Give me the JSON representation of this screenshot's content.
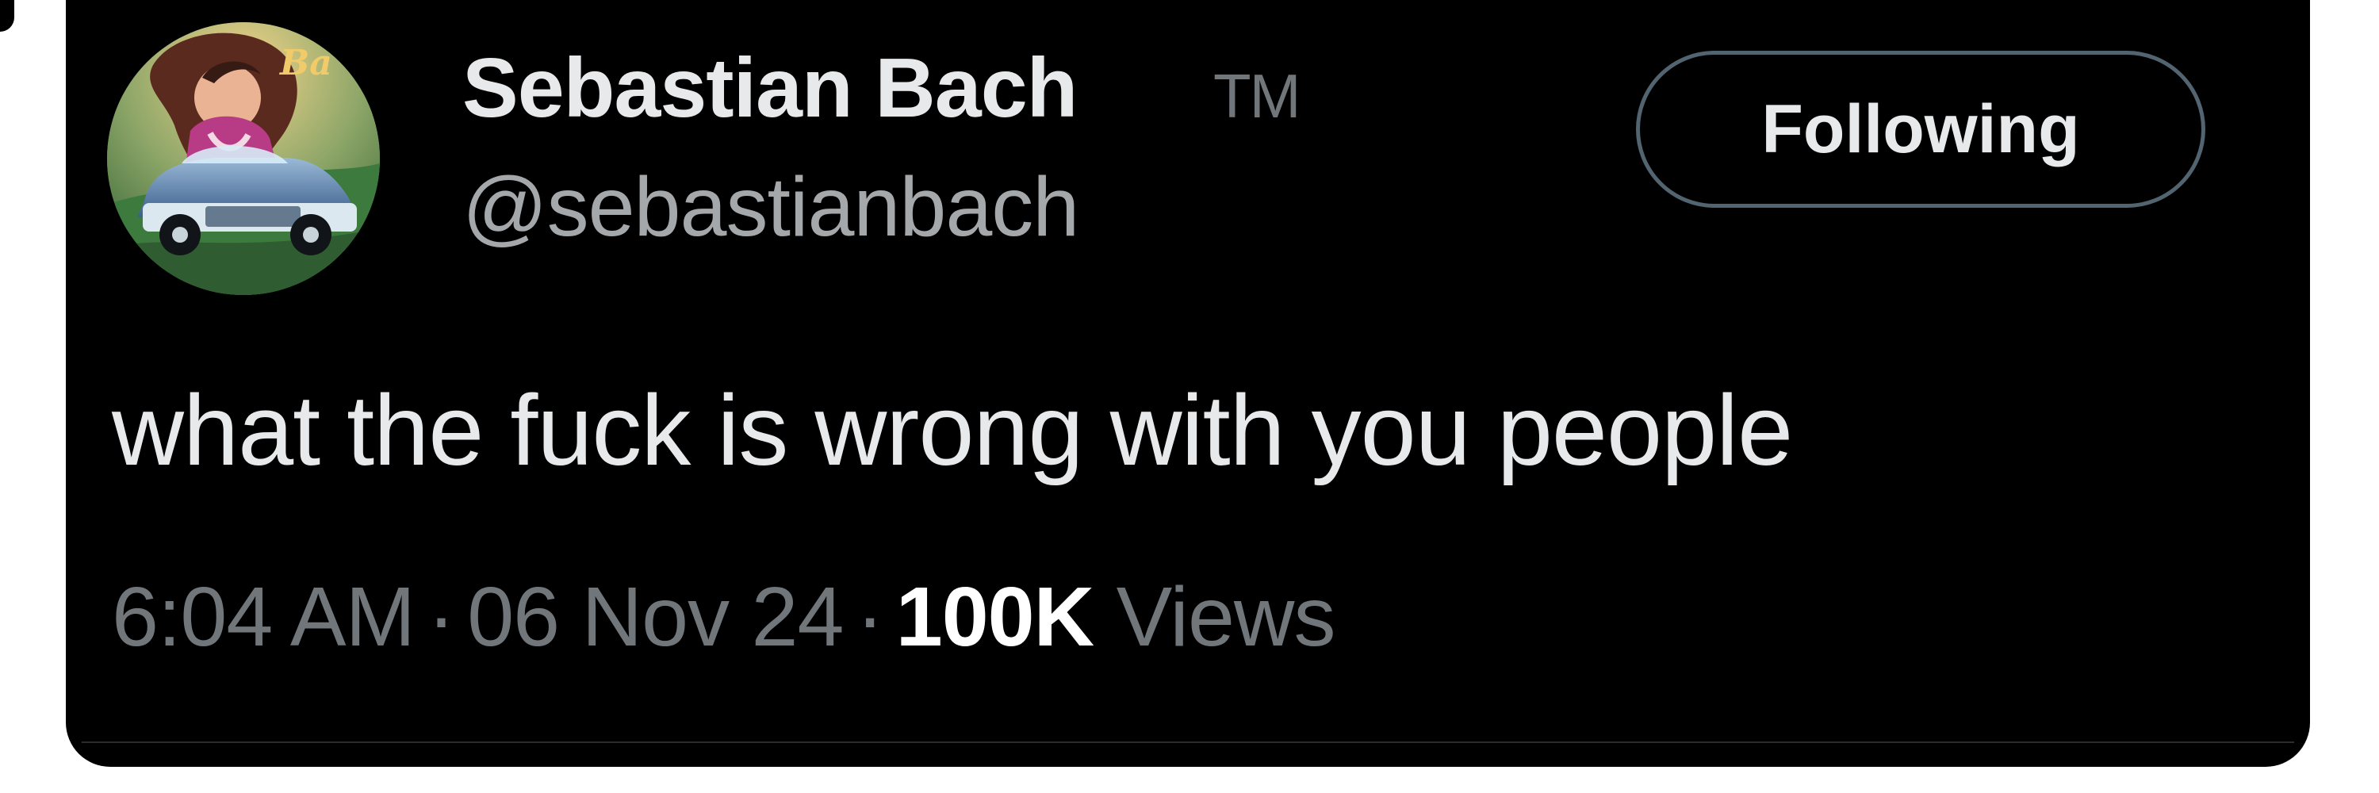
{
  "author": {
    "display_name": "Sebastian Bach",
    "badge": "TM",
    "handle": "@sebastianbach",
    "avatar_icon": "avatar-photo-icon"
  },
  "follow_button": {
    "label": "Following"
  },
  "tweet": {
    "text": "what the fuck is wrong with you people"
  },
  "meta": {
    "time": "6:04 AM",
    "separator": "·",
    "date": "06 Nov 24",
    "views_count": "100K",
    "views_label": "Views"
  },
  "colors": {
    "background": "#000000",
    "primary_text": "#e7e9ea",
    "secondary_text": "#71767b",
    "button_border": "#536471"
  }
}
